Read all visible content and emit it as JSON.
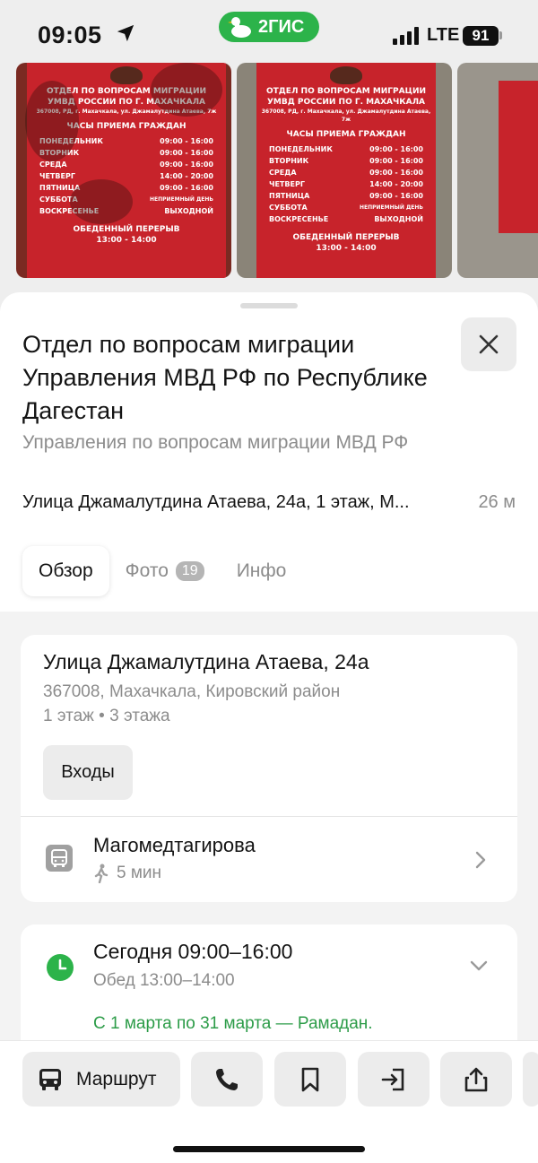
{
  "status_bar": {
    "time": "09:05",
    "network": "LTE",
    "battery": "91",
    "brand": "2ГИС"
  },
  "photos": [
    {
      "lines": [
        "ОТДЕЛ ПО ВОПРОСАМ МИГРАЦИИ",
        "УМВД РОССИИ ПО Г. МАХАЧКАЛА"
      ],
      "small": "367008, РД, г. Махачкала, ул. Джамалутдина Атаева, 7ж",
      "hours_title": "ЧАСЫ ПРИЕМА ГРАЖДАН",
      "schedule": [
        {
          "day": "ПОНЕДЕЛЬНИК",
          "time": "09:00 - 16:00"
        },
        {
          "day": "ВТОРНИК",
          "time": "09:00 - 16:00"
        },
        {
          "day": "СРЕДА",
          "time": "09:00 - 16:00"
        },
        {
          "day": "ЧЕТВЕРГ",
          "time": "14:00 - 20:00"
        },
        {
          "day": "ПЯТНИЦА",
          "time": "09:00 - 16:00"
        },
        {
          "day": "СУББОТА",
          "time": "НЕПРИЕМНЫЙ ДЕНЬ"
        },
        {
          "day": "ВОСКРЕСЕНЬЕ",
          "time": "ВЫХОДНОЙ"
        }
      ],
      "break_title": "ОБЕДЕННЫЙ ПЕРЕРЫВ",
      "break_time": "13:00 - 14:00"
    }
  ],
  "place": {
    "title": "Отдел по вопросам миграции Управления МВД РФ по Республике Дагестан",
    "subtitle": "Управления по вопросам миграции МВД РФ",
    "address_line": "Улица Джамалутдина Атаева, 24а, 1 этаж, М...",
    "distance": "26 м"
  },
  "tabs": [
    {
      "label": "Обзор",
      "active": true
    },
    {
      "label": "Фото",
      "badge": "19"
    },
    {
      "label": "Инфо"
    }
  ],
  "address_card": {
    "street": "Улица Джамалутдина Атаева, 24а",
    "postal_city": "367008, Махачкала, Кировский район",
    "floors": "1 этаж • 3 этажа",
    "entrances_label": "Входы",
    "stop_name": "Магомедтагирова",
    "walk_time": "5 мин"
  },
  "hours_card": {
    "today": "Сегодня 09:00–16:00",
    "lunch": "Обед 13:00–14:00",
    "note": "С 1 марта по 31 марта — Рамадан."
  },
  "bottom_bar": {
    "route_label": "Маршрут"
  },
  "colors": {
    "accent_green": "#2cb34a",
    "sign_red": "#c7232b",
    "note_green": "#2c9c48"
  }
}
